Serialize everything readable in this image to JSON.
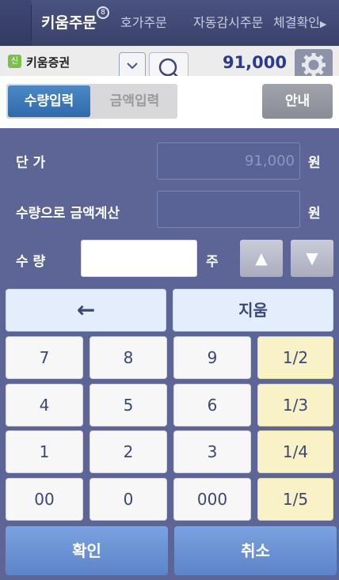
{
  "tabs": [
    {
      "label": "키움주문",
      "active": true
    },
    {
      "label": "호가주문",
      "active": false
    },
    {
      "label": "자동감시주문",
      "active": false
    },
    {
      "label": "체결확인",
      "active": false
    }
  ],
  "tab_badge": "8",
  "tab_more_arrow": "▶",
  "account": {
    "icon_text": "신",
    "name": "키움증권",
    "price": "91,000"
  },
  "mode_tabs": {
    "quantity": "수량입력",
    "amount": "금액입력",
    "selected": "수량입력"
  },
  "guide_button": "안내",
  "form": {
    "unit_price_label": "단 가",
    "unit_price_value": "91,000",
    "currency_unit": "원",
    "amount_calc_label": "수량으로 금액계산",
    "amount_calc_value": "",
    "quantity_label": "수 량",
    "quantity_value": "",
    "quantity_unit": "주",
    "up_symbol": "▲",
    "down_symbol": "▼"
  },
  "keypad": {
    "backspace": "←",
    "clear": "지움",
    "rows": [
      [
        "7",
        "8",
        "9",
        "1/2"
      ],
      [
        "4",
        "5",
        "6",
        "1/3"
      ],
      [
        "1",
        "2",
        "3",
        "1/4"
      ],
      [
        "00",
        "0",
        "000",
        "1/5"
      ]
    ],
    "confirm": "확인",
    "cancel": "취소"
  },
  "colors": {
    "background": "#5c6596",
    "active_segment": "#2f6aab",
    "fraction_key": "#f9f2c7",
    "action_button": "#6b92d6",
    "price_text": "#2b3a8f"
  },
  "icons": [
    "search-icon",
    "gear-icon",
    "chevron-down-icon",
    "backspace-arrow-icon",
    "triangle-up-icon",
    "triangle-down-icon"
  ]
}
